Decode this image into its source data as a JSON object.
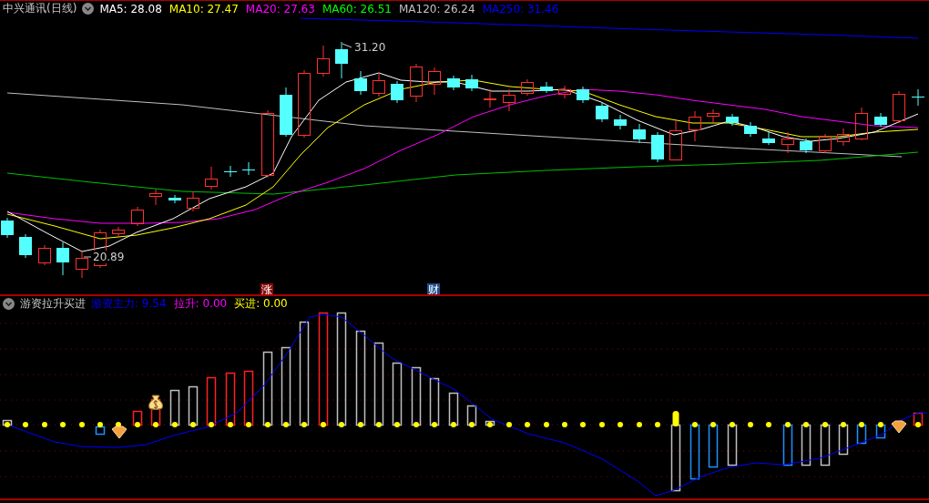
{
  "main_panel": {
    "title": "中兴通讯(日线)",
    "indicators": [
      {
        "label": "MA5: 28.08",
        "color": "#ffffff"
      },
      {
        "label": "MA10: 27.47",
        "color": "#ffff00"
      },
      {
        "label": "MA20: 27.63",
        "color": "#ff00ff"
      },
      {
        "label": "MA60: 26.51",
        "color": "#00ff00"
      },
      {
        "label": "MA120: 26.24",
        "color": "#c0c0c0"
      },
      {
        "label": "MA250: 31.46",
        "color": "#0000ff"
      }
    ],
    "high_label": "31.20",
    "low_label": "20.89",
    "event_badges": [
      {
        "text": "涨",
        "color": "#8b0a0a"
      },
      {
        "text": "财",
        "color": "#1f4f8a"
      }
    ]
  },
  "sub_panel": {
    "title": "游资拉升买进",
    "indicators": [
      {
        "label": "游资主力: 9.54",
        "color": "#0000ff"
      },
      {
        "label": "拉升: 0.00",
        "color": "#ff00ff"
      },
      {
        "label": "买进: 0.00",
        "color": "#ffff00"
      }
    ]
  }
}
